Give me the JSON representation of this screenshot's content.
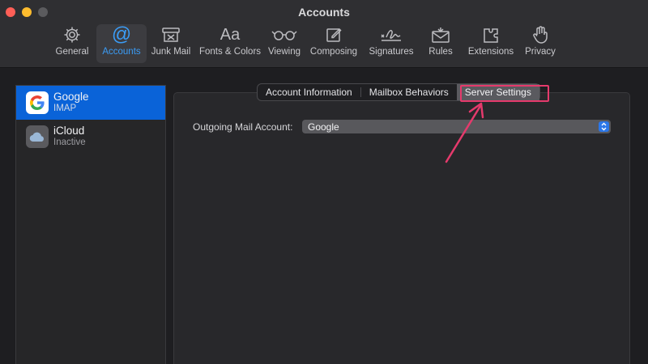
{
  "window": {
    "title": "Accounts"
  },
  "toolbar": {
    "items": [
      {
        "label": "General",
        "icon": "gear-icon"
      },
      {
        "label": "Accounts",
        "icon": "at-sign-icon"
      },
      {
        "label": "Junk Mail",
        "icon": "junk-mail-icon"
      },
      {
        "label": "Fonts & Colors",
        "icon": "fonts-icon",
        "glyph": "Aa"
      },
      {
        "label": "Viewing",
        "icon": "glasses-icon"
      },
      {
        "label": "Composing",
        "icon": "compose-icon"
      },
      {
        "label": "Signatures",
        "icon": "signature-icon"
      },
      {
        "label": "Rules",
        "icon": "rules-icon"
      },
      {
        "label": "Extensions",
        "icon": "puzzle-icon"
      },
      {
        "label": "Privacy",
        "icon": "hand-icon"
      }
    ],
    "selected": "Accounts"
  },
  "sidebar": {
    "accounts": [
      {
        "name": "Google",
        "status": "IMAP",
        "icon": "google-icon"
      },
      {
        "name": "iCloud",
        "status": "Inactive",
        "icon": "icloud-icon"
      }
    ],
    "selected": "Google"
  },
  "tabs": {
    "items": [
      {
        "label": "Account Information"
      },
      {
        "label": "Mailbox Behaviors"
      },
      {
        "label": "Server Settings"
      }
    ],
    "selected": "Server Settings"
  },
  "server_settings": {
    "outgoing_label": "Outgoing Mail Account:",
    "outgoing_value": "Google"
  },
  "colors": {
    "accent": "#0a63d8",
    "annotation": "#e53a6c",
    "toolbar_active": "#3b9cf5"
  }
}
